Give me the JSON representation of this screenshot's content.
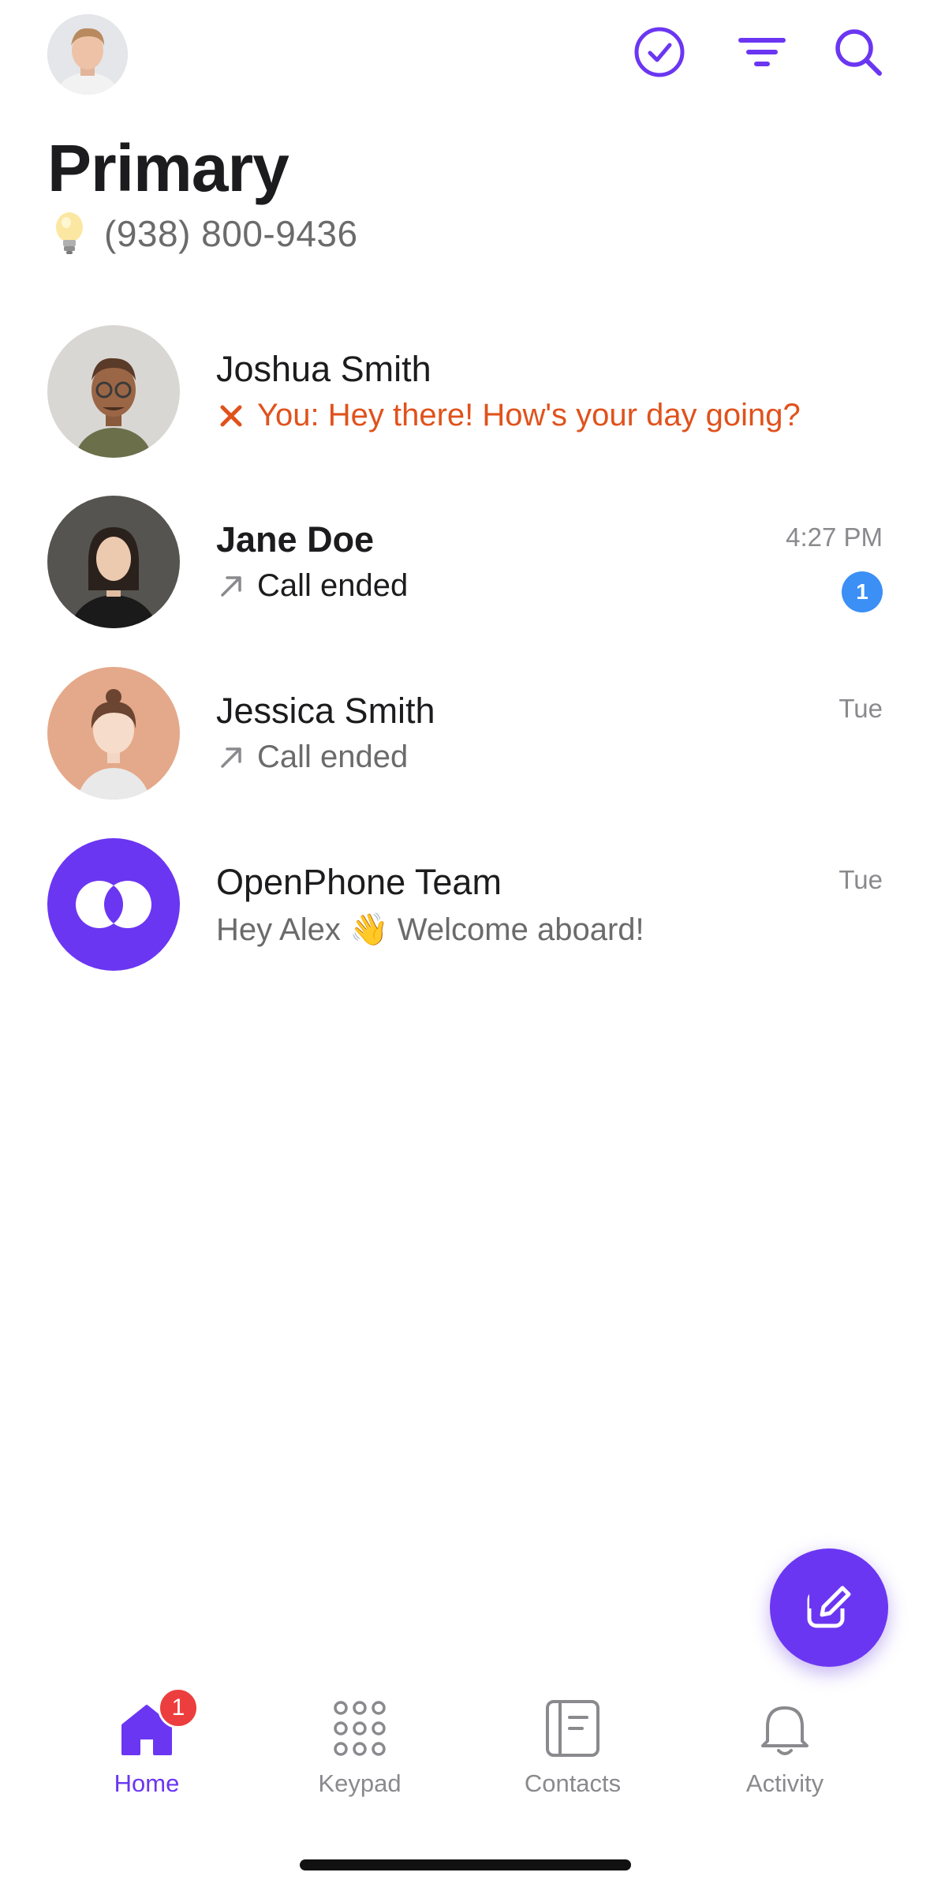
{
  "header": {
    "title": "Primary",
    "phone_number": "(938) 800-9436"
  },
  "toolbar": {
    "icons": [
      "check-circle-icon",
      "filter-icon",
      "search-icon"
    ],
    "accent": "#6b36f2"
  },
  "conversations": [
    {
      "name": "Joshua Smith",
      "preview": "You: Hey there! How's your day going?",
      "preview_icon": "x-icon",
      "status": "failed",
      "time": "",
      "unread": "",
      "bold": false
    },
    {
      "name": "Jane Doe",
      "preview": "Call ended",
      "preview_icon": "outgoing-arrow-icon",
      "time": "4:27 PM",
      "unread": "1",
      "bold": true
    },
    {
      "name": "Jessica Smith",
      "preview": "Call ended",
      "preview_icon": "outgoing-arrow-icon",
      "time": "Tue",
      "unread": "",
      "bold": false
    },
    {
      "name": "OpenPhone Team",
      "preview": "Hey Alex 👋 Welcome aboard!",
      "preview_icon": "",
      "time": "Tue",
      "unread": "",
      "bold": false
    }
  ],
  "tabs": [
    {
      "label": "Home",
      "icon": "home-icon",
      "active": true,
      "badge": "1"
    },
    {
      "label": "Keypad",
      "icon": "keypad-icon",
      "active": false,
      "badge": ""
    },
    {
      "label": "Contacts",
      "icon": "contacts-icon",
      "active": false,
      "badge": ""
    },
    {
      "label": "Activity",
      "icon": "bell-icon",
      "active": false,
      "badge": ""
    }
  ],
  "colors": {
    "accent": "#6b36f2",
    "error": "#e0521c",
    "unread_badge": "#3b8ff5",
    "tab_badge": "#ec3e3e"
  }
}
